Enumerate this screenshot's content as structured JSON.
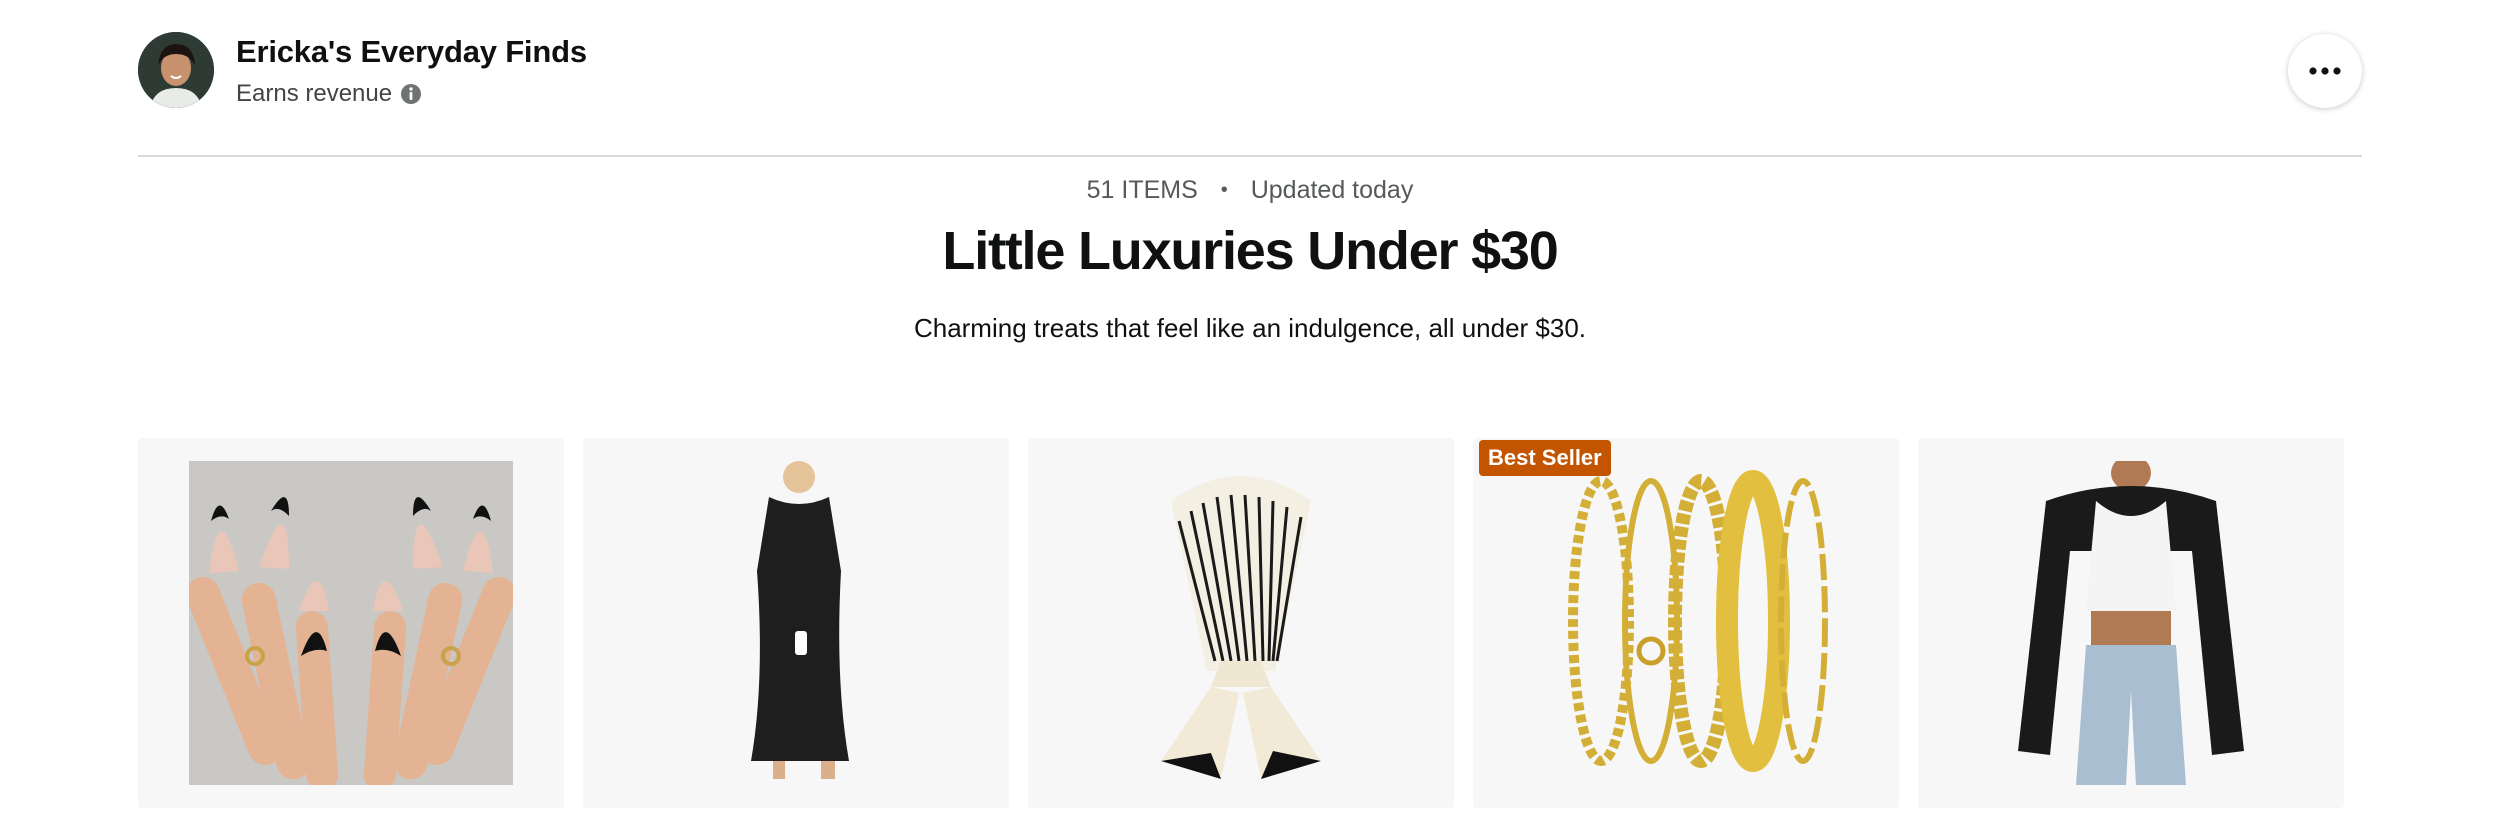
{
  "creator": {
    "name": "Ericka's Everyday Finds",
    "earns_label": "Earns revenue",
    "avatar_icon": "avatar-photo",
    "info_icon": "info-icon"
  },
  "more_button": {
    "icon": "ellipsis-icon"
  },
  "list": {
    "item_count": "51 ITEMS",
    "separator": "•",
    "updated": "Updated today",
    "title": "Little Luxuries Under $30",
    "description": "Charming treats that feel like an indulgence, all under $30."
  },
  "products": [
    {
      "name": "press-on-nails",
      "badge": ""
    },
    {
      "name": "black-maxi-dress",
      "badge": ""
    },
    {
      "name": "striped-silk-scarf",
      "badge": ""
    },
    {
      "name": "gold-bracelet-set",
      "badge": "Best Seller"
    },
    {
      "name": "black-shrug-cardigan",
      "badge": ""
    }
  ],
  "colors": {
    "badge": "#c45500",
    "card_bg": "#f7f7f7",
    "divider": "#d5d9d9"
  }
}
